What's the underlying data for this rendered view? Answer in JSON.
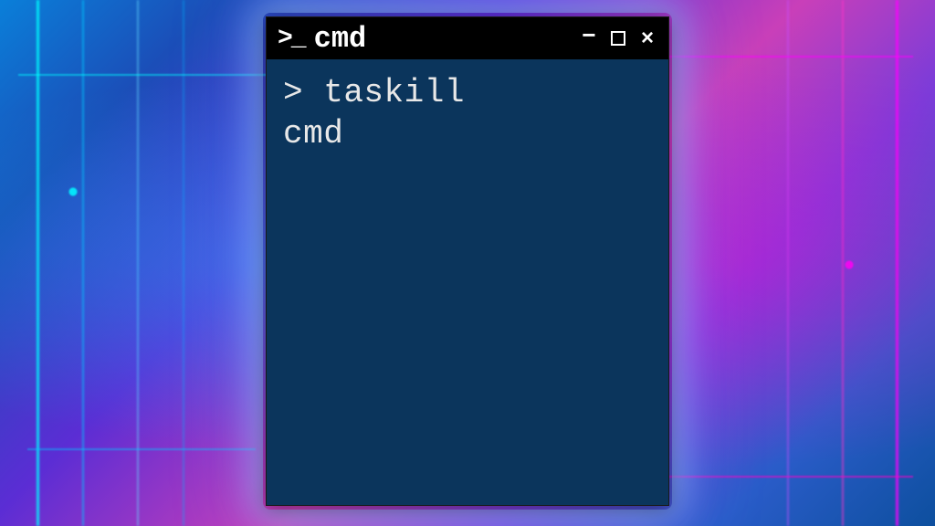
{
  "window": {
    "icon_glyph": ">_",
    "title": "cmd"
  },
  "terminal": {
    "prompt": ">",
    "command_line1": "taskill",
    "command_line2": "cmd"
  },
  "colors": {
    "terminal_bg": "#0b355c",
    "titlebar_bg": "#000000",
    "text": "#e8e8e8"
  }
}
